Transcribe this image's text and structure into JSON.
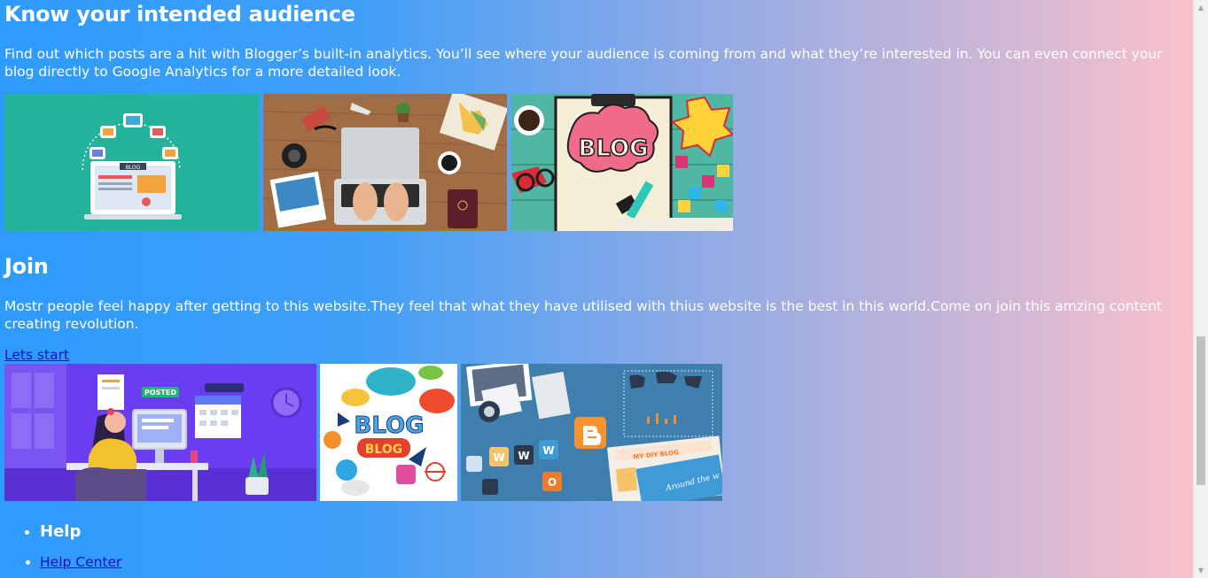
{
  "section_audience": {
    "heading": "Know your intended audience",
    "body": "Find out which posts are a hit with Blogger’s built-in analytics. You’ll see where your audience is coming from and what they’re interested in. You can even connect your blog directly to Google Analytics for a more detailed look.",
    "images": [
      {
        "name": "blog-analytics-illustration",
        "caption": "BLOG"
      },
      {
        "name": "laptop-desk-photo",
        "caption": ""
      },
      {
        "name": "blog-clipboard-illustration",
        "caption": "BLOG"
      }
    ]
  },
  "section_join": {
    "heading": "Join",
    "body": "Mostr people feel happy after getting to this website.They feel that what they have utilised with thius website is the best in this world.Come on join this amzing content creating revolution.",
    "cta_link": "Lets start",
    "images": [
      {
        "name": "posted-woman-illustration",
        "caption": "POSTED"
      },
      {
        "name": "blog-words-collage",
        "caption": "BLOG"
      },
      {
        "name": "blogger-desk-illustration",
        "caption": "MY DIY BLOG"
      }
    ]
  },
  "footer": {
    "help_title": "Help",
    "help_center_link": "Help Center"
  },
  "colors": {
    "gradient_left": "#2e9bff",
    "gradient_right": "#fbc1cb",
    "link": "#1a0dcc",
    "text": "#ffffff"
  }
}
